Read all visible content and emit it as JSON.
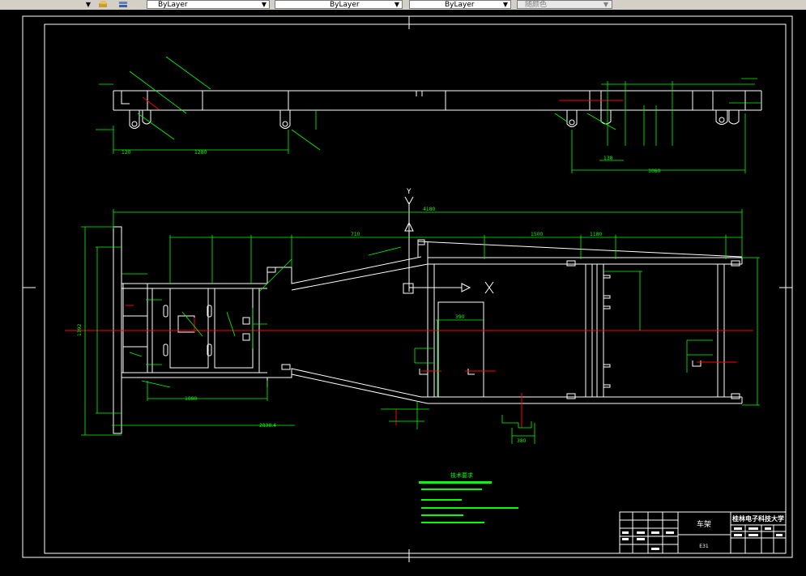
{
  "toolbar": {
    "layer_label": "ByLayer",
    "linetype_label": "ByLayer",
    "lineweight_label": "ByLayer",
    "plotstyle_label": "随颜色"
  },
  "drawing": {
    "tech_req_title": "技术要求",
    "title_block": {
      "part_name": "车架",
      "school": "桂林电子科技大学",
      "drawing_no": "E31"
    },
    "dims": {
      "overall_length": "4180",
      "d_1080": "1080",
      "d_2838": "2838.4",
      "d_1392": "1392",
      "d_1280": "1280",
      "d_390": "390",
      "d_380": "380",
      "d_710": "710",
      "d_1180": "1180",
      "d_1500": "1500",
      "d_3060": "3060",
      "d_138": "138",
      "d_120": "120"
    },
    "colors": {
      "outline": "#ffffff",
      "dimension": "#00ff00",
      "centerline": "#ff0000",
      "titlebar": "#00ff00"
    }
  }
}
